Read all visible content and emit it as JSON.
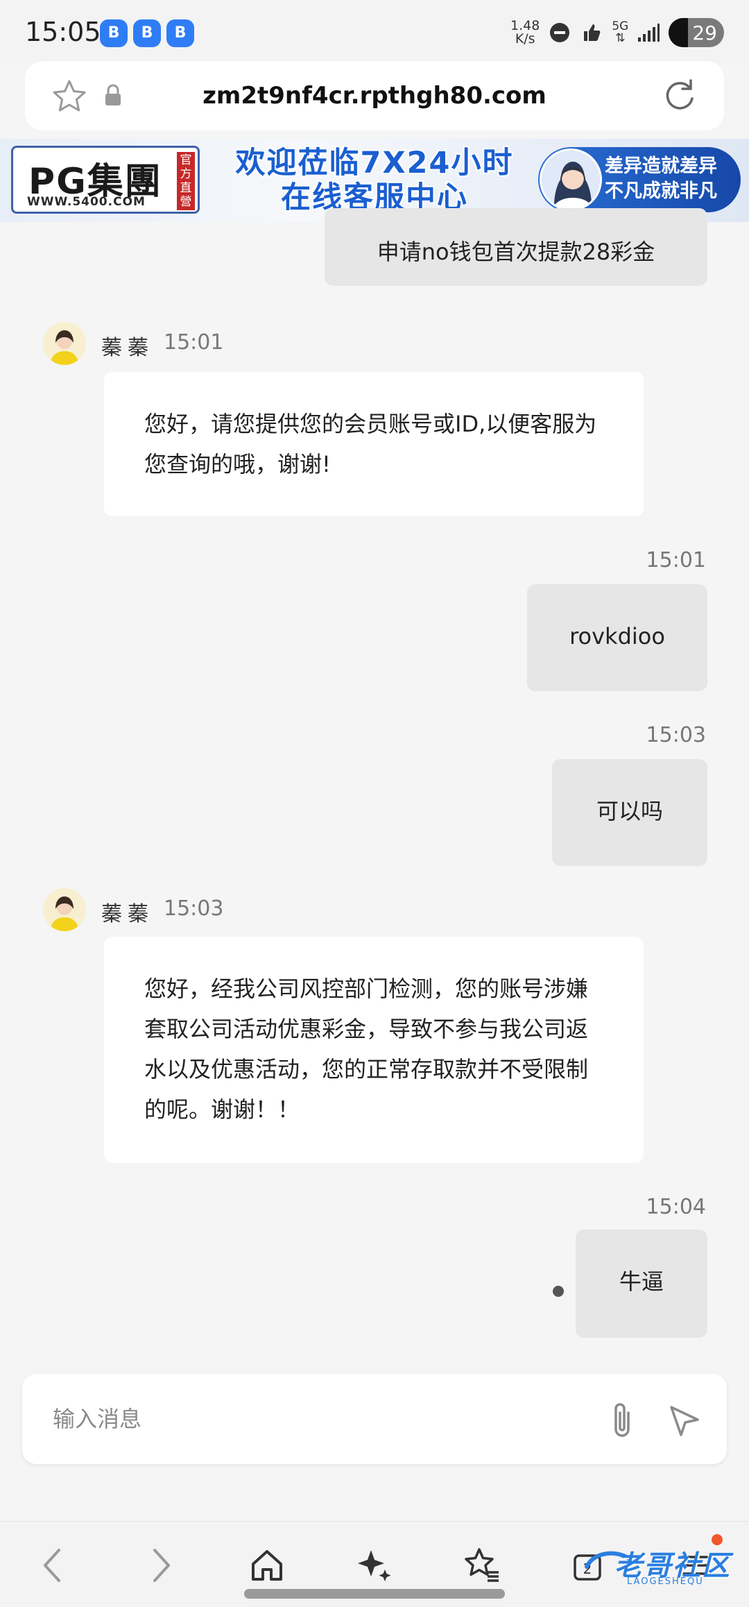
{
  "status_bar": {
    "time": "15:05",
    "app_badges": [
      "B",
      "B",
      "B"
    ],
    "net_speed_value": "1.48",
    "net_speed_unit": "K/s",
    "network": "5G",
    "battery": "29"
  },
  "browser": {
    "url": "zm2t9nf4cr.rpthgh80.com"
  },
  "banner": {
    "logo_main": "PG集團",
    "logo_side": "官方直營",
    "logo_sub": "WWW.5400.COM",
    "line1": "欢迎莅临7X24小时",
    "line2": "在线客服中心",
    "right_line1": "差异造就差异",
    "right_line2": "不凡成就非凡"
  },
  "chat": {
    "messages": [
      {
        "from": "me",
        "text": "申请no钱包首次提款28彩金"
      },
      {
        "from": "agent",
        "name": "蓁蓁",
        "time": "15:01",
        "text": "您好，请您提供您的会员账号或ID,以便客服为您查询的哦，谢谢!"
      },
      {
        "from": "me",
        "time": "15:01",
        "text": "rovkdioo"
      },
      {
        "from": "me",
        "time": "15:03",
        "text": "可以吗"
      },
      {
        "from": "agent",
        "name": "蓁蓁",
        "time": "15:03",
        "text": "您好，经我公司风控部门检测，您的账号涉嫌套取公司活动优惠彩金，导致不参与我公司返水以及优惠活动，您的正常存取款并不受限制的呢。谢谢！！"
      },
      {
        "from": "me",
        "time": "15:04",
        "text": "牛逼"
      }
    ]
  },
  "composer": {
    "placeholder": "输入消息"
  },
  "bottom_nav": {
    "tabs_count": "2",
    "watermark_text": "老哥社区",
    "watermark_sub": "LAOGESHEQU"
  },
  "icons": {
    "star": "star-icon",
    "lock": "lock-icon",
    "reload": "reload-icon",
    "attach": "paperclip-icon",
    "send": "send-icon",
    "back": "chevron-left-icon",
    "forward": "chevron-right-icon",
    "home": "home-icon",
    "ai": "sparkle-icon",
    "favorites": "favorites-icon",
    "tabs": "tabs-icon"
  },
  "colors": {
    "background": "#f5f5f5",
    "my_bubble": "#e6e6e6",
    "agent_bubble": "#ffffff",
    "brand_blue": "#1a5fd0"
  }
}
